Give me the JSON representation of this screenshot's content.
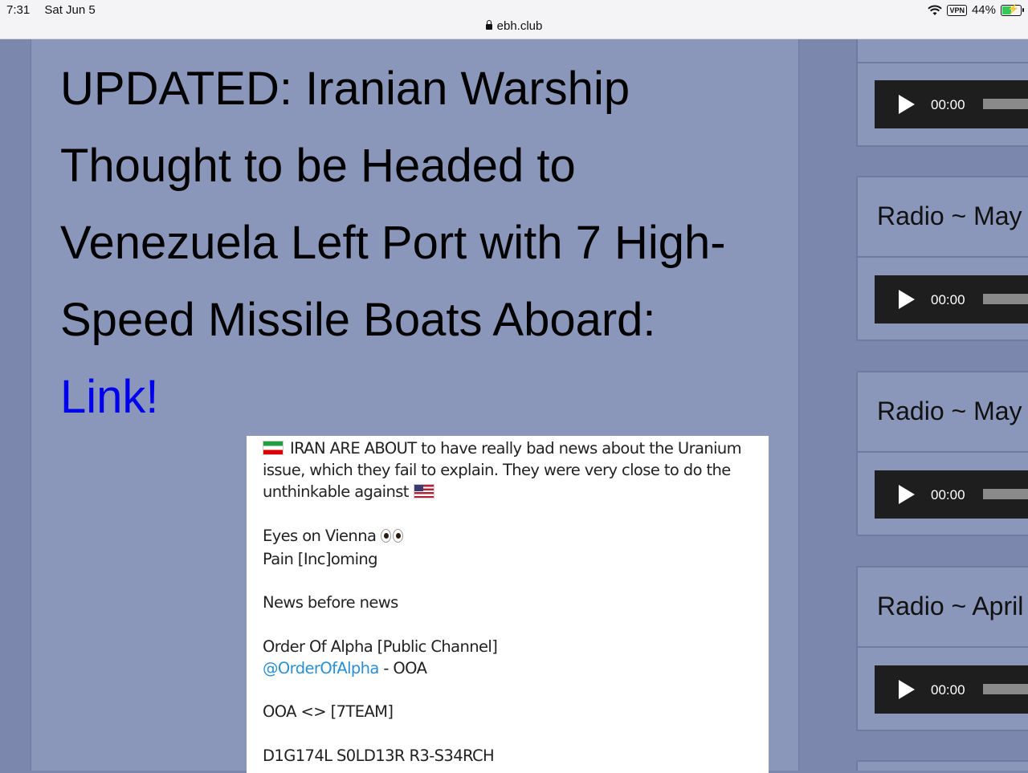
{
  "status_bar": {
    "time": "7:31",
    "date": "Sat Jun 5",
    "vpn": "VPN",
    "battery": "44%",
    "battery_level": 0.44
  },
  "browser": {
    "url": "ebh.club"
  },
  "post": {
    "title": "UPDATED: Iranian Warship Thought to be Headed to Venezuela Left Port with 7 High-Speed Missile Boats Aboard:",
    "link_label": "Link!"
  },
  "embed": {
    "line1": "IRAN ARE ABOUT to have really bad news about the Uranium issue, which they fail to explain. They were very close to do the unthinkable against",
    "line2a": "Eyes on Vienna",
    "line2b": "Pain [Inc]oming",
    "line3": "News before news",
    "line4a": "Order Of Alpha [Public Channel]",
    "line4_handle": "@OrderOfAlpha",
    "line4_suffix": " - OOA",
    "line5": "OOA <> [7TEAM]",
    "line6": "D1G174L S0LD13R R3-S34RCH"
  },
  "sidebar": {
    "widgets": [
      {
        "title": "",
        "time": "00:00"
      },
      {
        "title": "Radio ~ May",
        "time": "00:00"
      },
      {
        "title": "Radio ~ May",
        "time": "00:00"
      },
      {
        "title": "Radio ~ April",
        "time": "00:00"
      }
    ]
  },
  "colors": {
    "page_bg": "#7b87ad",
    "panel_bg": "#8a97bb",
    "link": "#0000ee",
    "telegram_link": "#2a8fd4",
    "player_bg": "#1e1e1e"
  }
}
